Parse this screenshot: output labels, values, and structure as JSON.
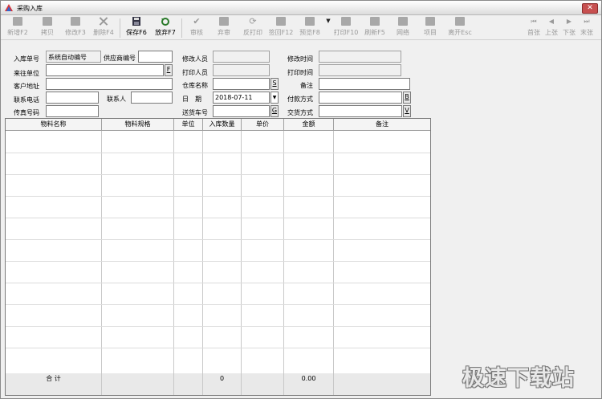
{
  "window": {
    "title": "采购入库",
    "close_label": "✕"
  },
  "toolbar": {
    "new": "新增F2",
    "copy": "拷贝",
    "modify": "修改F3",
    "delete": "删除F4",
    "save": "保存F6",
    "discard": "放弃F7",
    "audit": "审核",
    "unaudit": "弃审",
    "unprint": "反打印",
    "sign": "签回F12",
    "preview": "预览F8",
    "print": "打印F10",
    "refresh": "刷新F5",
    "grid": "网络",
    "item": "项目",
    "exit": "离开Esc",
    "first": "首张",
    "prev": "上张",
    "next": "下张",
    "last": "末张"
  },
  "form": {
    "doc_no_label": "入库单号",
    "doc_no_value": "系统自动编号",
    "supplier_no_label": "供应商编号",
    "supplier_no_value": "",
    "partner_label": "来往单位",
    "partner_value": "",
    "partner_btn": "F",
    "address_label": "客户地址",
    "address_value": "",
    "phone_label": "联系电话",
    "phone_value": "",
    "contact_label": "联系人",
    "contact_value": "",
    "fax_label": "传真号码",
    "fax_value": "",
    "modifier_label": "修改人员",
    "modifier_value": "",
    "printer_label": "打印人员",
    "printer_value": "",
    "warehouse_label": "仓库名称",
    "warehouse_value": "",
    "warehouse_btn": "S",
    "date_label": "日　期",
    "date_value": "2018-07-11",
    "driver_label": "送货车号",
    "driver_value": "",
    "driver_btn": "G",
    "modtime_label": "修改时间",
    "modtime_value": "",
    "printtime_label": "打印时间",
    "printtime_value": "",
    "remark_label": "备注",
    "remark_value": "",
    "payment_label": "付款方式",
    "payment_value": "",
    "payment_btn": "B",
    "delivery_label": "交货方式",
    "delivery_value": "",
    "delivery_btn": "V"
  },
  "grid": {
    "columns": [
      "物料名称",
      "物料规格",
      "单位",
      "入库数量",
      "单价",
      "金额",
      "备注"
    ],
    "footer": {
      "label": "合 计",
      "qty_total": "0",
      "amount_total": "0.00"
    }
  },
  "watermark": "极速下载站",
  "colors": {
    "close": "#c75050",
    "window_bg": "#f0f0f0"
  }
}
